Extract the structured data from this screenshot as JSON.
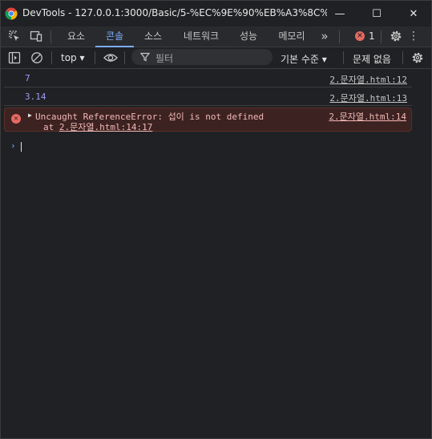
{
  "window": {
    "title": "DevTools - 127.0.0.1:3000/Basic/5-%EC%9E%90%EB%A3%8C%ED%...",
    "min_glyph": "—",
    "max_glyph": "☐",
    "close_glyph": "✕"
  },
  "tabs": [
    {
      "label": "요소"
    },
    {
      "label": "콘솔"
    },
    {
      "label": "소스"
    },
    {
      "label": "네트워크"
    },
    {
      "label": "성능"
    },
    {
      "label": "메모리"
    }
  ],
  "toolbar": {
    "more_glyph": "»",
    "error_count": "1",
    "error_glyph": "✕",
    "kebab_glyph": "⋮"
  },
  "filterbar": {
    "context": "top ▾",
    "filter_placeholder": "필터",
    "levels": "기본 수준 ▾",
    "issues": "문제 없음"
  },
  "console": {
    "messages": [
      {
        "value": "7",
        "source": "2.문자열.html:12"
      },
      {
        "value": "3.14",
        "source": "2.문자열.html:13"
      }
    ],
    "error": {
      "message": "Uncaught ReferenceError: 섭이 is not defined",
      "at_prefix": "at ",
      "at_link": "2.문자열.html:14:17",
      "source": "2.문자열.html:14",
      "icon_glyph": "✕",
      "expand_glyph": "▶"
    },
    "prompt_glyph": "›"
  },
  "colors": {
    "accent": "#7cacf8",
    "error": "#e46962",
    "number": "#9e9cf5",
    "background": "#202124"
  }
}
